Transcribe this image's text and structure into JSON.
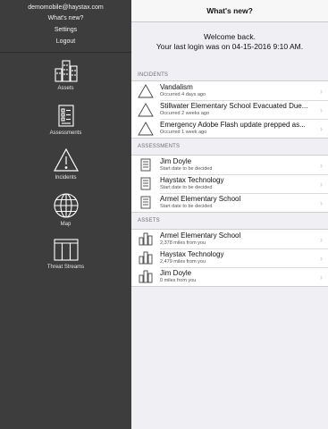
{
  "account": {
    "email": "demomobile@haystax.com",
    "menu": [
      "What's new?",
      "Settings",
      "Logout"
    ]
  },
  "nav": [
    {
      "label": "Assets",
      "icon": "buildings-icon"
    },
    {
      "label": "Assessments",
      "icon": "checklist-icon"
    },
    {
      "label": "Incidents",
      "icon": "warning-icon"
    },
    {
      "label": "Map",
      "icon": "globe-icon"
    },
    {
      "label": "Threat Streams",
      "icon": "columns-icon"
    }
  ],
  "header": {
    "title": "What's new?"
  },
  "welcome": {
    "line1": "Welcome back.",
    "line2": "Your last login was on 04-15-2016 9:10 AM."
  },
  "incidents": {
    "header": "INCIDENTS",
    "items": [
      {
        "title": "Vandalism",
        "sub": "Occurred 4 days ago"
      },
      {
        "title": "Stillwater Elementary School Evacuated Due...",
        "sub": "Occurred 2 weeks ago"
      },
      {
        "title": "Emergency Adobe Flash update prepped as...",
        "sub": "Occurred 1 week ago"
      }
    ]
  },
  "assessments": {
    "header": "ASSESSMENTS",
    "items": [
      {
        "title": "Jim Doyle",
        "sub": "Start date to be decided"
      },
      {
        "title": "Haystax Technology",
        "sub": "Start date to be decided"
      },
      {
        "title": "Armel Elementary School",
        "sub": "Start date to be decided"
      }
    ]
  },
  "assets": {
    "header": "ASSETS",
    "items": [
      {
        "title": "Armel Elementary School",
        "sub": "2,378 miles from you"
      },
      {
        "title": "Haystax Technology",
        "sub": "2,479 miles from you"
      },
      {
        "title": "Jim Doyle",
        "sub": "0 miles from you"
      }
    ]
  },
  "colors": {
    "sidebar": "#3d3d3d",
    "background": "#efeff4",
    "chevron": "#c4c4c8"
  }
}
